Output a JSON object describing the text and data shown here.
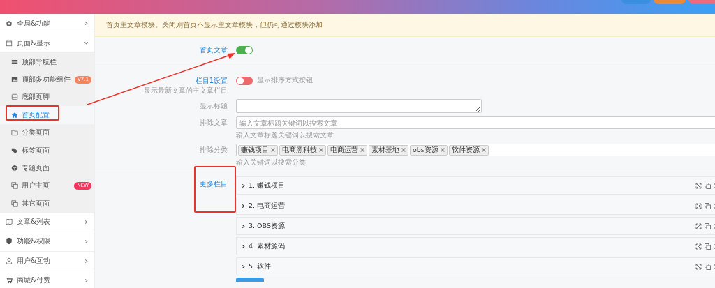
{
  "sidebar": {
    "items": [
      {
        "label": "全局&功能",
        "expanded": false
      },
      {
        "label": "页面&显示",
        "expanded": true,
        "children": [
          {
            "label": "顶部导航栏",
            "selected": false
          },
          {
            "label": "顶部多功能组件",
            "selected": false,
            "badge": {
              "text": "V7.1",
              "color": "#f4845f"
            }
          },
          {
            "label": "底部页脚",
            "selected": false
          },
          {
            "label": "首页配置",
            "selected": true
          },
          {
            "label": "分类页面",
            "selected": false
          },
          {
            "label": "标签页面",
            "selected": false
          },
          {
            "label": "专题页面",
            "selected": false
          },
          {
            "label": "用户主页",
            "selected": false,
            "badge": {
              "text": "NEW",
              "color": "#f5365c"
            }
          },
          {
            "label": "其它页面",
            "selected": false
          }
        ]
      },
      {
        "label": "文章&列表",
        "expanded": false
      },
      {
        "label": "功能&权限",
        "expanded": false
      },
      {
        "label": "用户&互动",
        "expanded": false
      },
      {
        "label": "商城&付费",
        "expanded": false
      }
    ]
  },
  "main": {
    "notice": "首页主文章模块。关闭则首页不显示主文章模块，但仍可通过模块添加",
    "home_article": {
      "label": "首页文章",
      "on": true
    },
    "column1": {
      "label": "栏目1设置",
      "description": "显示最新文章的主文章栏目",
      "sort_toggle": {
        "on": false,
        "label": "显示排序方式按钮"
      },
      "fields": [
        {
          "kind": "textarea",
          "label": "显示标题"
        },
        {
          "kind": "search",
          "label": "排除文章",
          "placeholder": "输入文章标题关键词以搜索文章",
          "hint": "输入文章标题关键词以搜索文章"
        },
        {
          "kind": "tags",
          "label": "排除分类",
          "tags": [
            "赚钱项目",
            "电商黑科技",
            "电商运营",
            "素材基地",
            "obs资源",
            "软件资源"
          ],
          "hint": "输入关键词以搜索分类"
        }
      ]
    },
    "more_columns": {
      "label": "更多栏目",
      "items": [
        {
          "title": "1. 赚钱项目",
          "expanded": false
        },
        {
          "title": "2. 电商运营",
          "expanded": false
        },
        {
          "title": "3. OBS资源",
          "expanded": false
        },
        {
          "title": "4. 素材源码",
          "expanded": false
        },
        {
          "title": "5. 软件",
          "expanded": false
        }
      ]
    }
  }
}
